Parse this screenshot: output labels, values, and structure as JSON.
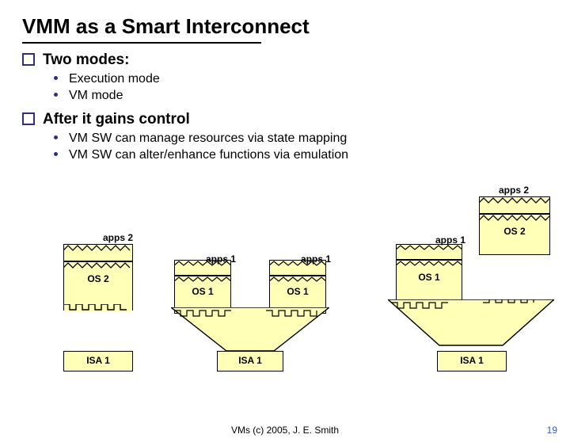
{
  "title": "VMM as a Smart Interconnect",
  "top1": "Two modes:",
  "sub1": "Execution mode",
  "sub2": "VM mode",
  "top2": "After it gains control",
  "sub3": "VM SW can manage resources via state mapping",
  "sub4": "VM SW can alter/enhance functions via emulation",
  "d": {
    "apps2": "apps 2",
    "apps1": "apps 1",
    "os2": "OS 2",
    "os1": "OS 1",
    "isa1": "ISA 1"
  },
  "footer": "VMs (c) 2005, J. E. Smith",
  "page": "19"
}
